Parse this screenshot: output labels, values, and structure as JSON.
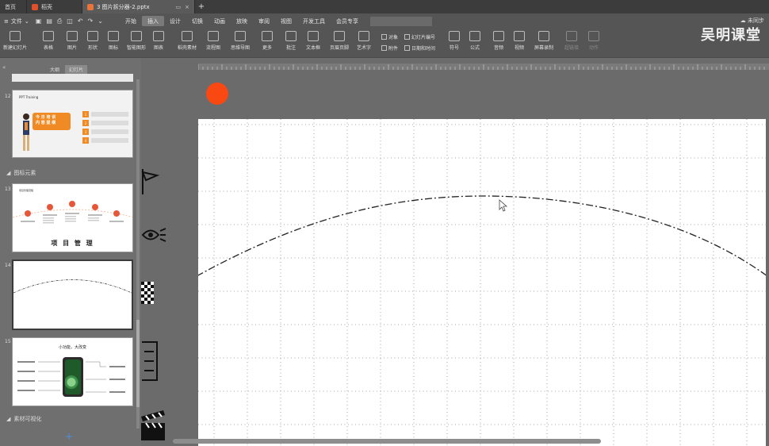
{
  "titlebar": {
    "tabs": [
      {
        "label": "首页"
      },
      {
        "label": "稻壳"
      },
      {
        "label": "3 图片拆分器-2.pptx"
      }
    ]
  },
  "menubar": {
    "file": "文件",
    "items": [
      "开始",
      "插入",
      "设计",
      "切换",
      "动画",
      "放映",
      "审阅",
      "视图",
      "开发工具",
      "会员专享"
    ],
    "active": "插入",
    "collab": "未同步"
  },
  "ribbon": {
    "buttons": [
      "新建幻灯片",
      "表格",
      "图片",
      "形状",
      "图标",
      "智能图形",
      "图表",
      "稻壳素材",
      "流程图",
      "思维导图",
      "更多",
      "批注",
      "文本框",
      "页眉页脚",
      "艺术字",
      "符号",
      "公式",
      "音频",
      "视频",
      "屏幕录制",
      "超链接",
      "动作"
    ],
    "small_buttons": [
      "对象",
      "幻灯片编号",
      "附件",
      "日期和时间"
    ]
  },
  "watermark": "吴明课堂",
  "leftpanel": {
    "tabs": [
      "大纲",
      "幻灯片"
    ],
    "active_tab": "幻灯片",
    "sections": [
      "图标元素",
      "素材可视化"
    ],
    "slides": [
      {
        "num": "12",
        "header": "PPT Training",
        "bubble_line1": "今 日 培 训",
        "bubble_line2": "内 容 提 纲"
      },
      {
        "num": "13",
        "header": "项目管理流程",
        "title": "项 目 管 理"
      },
      {
        "num": "14"
      },
      {
        "num": "15",
        "title": "小功能，大改变"
      }
    ]
  },
  "colors": {
    "accent_dot": "#fa4813",
    "orange": "#f08a24",
    "slide_bg": "#ffffff"
  }
}
